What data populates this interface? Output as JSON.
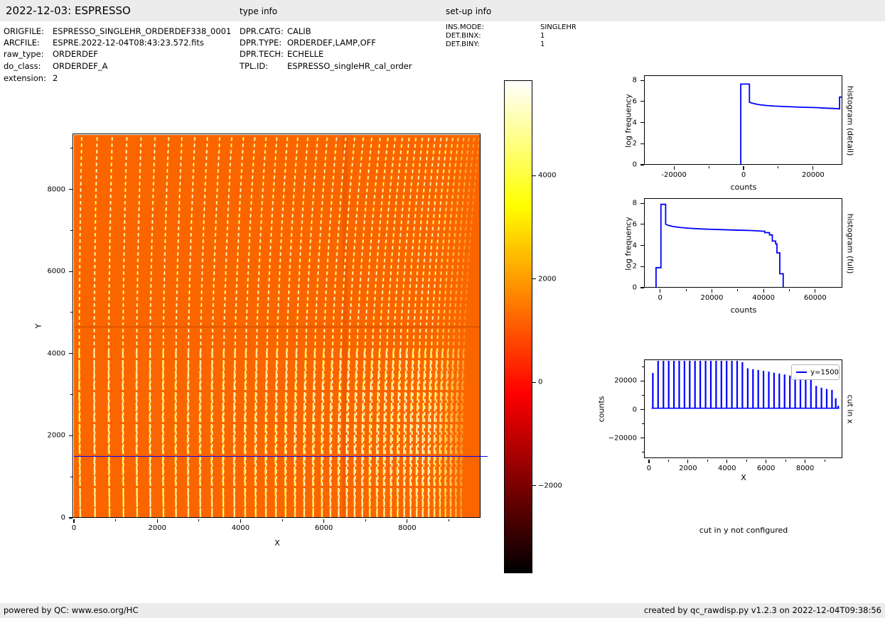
{
  "header": {
    "title": "2022-12-03: ESPRESSO",
    "type_info_label": "type info",
    "setup_info_label": "set-up info"
  },
  "file_info": {
    "rows": [
      {
        "label": "ORIGFILE:",
        "value": "ESPRESSO_SINGLEHR_ORDERDEF338_0001"
      },
      {
        "label": "ARCFILE:",
        "value": "ESPRE.2022-12-04T08:43:23.572.fits"
      },
      {
        "label": "raw_type:",
        "value": "ORDERDEF"
      },
      {
        "label": "do_class:",
        "value": "ORDERDEF_A"
      },
      {
        "label": "extension:",
        "value": "2"
      }
    ]
  },
  "type_info": {
    "rows": [
      {
        "label": "DPR.CATG:",
        "value": "CALIB"
      },
      {
        "label": "DPR.TYPE:",
        "value": "ORDERDEF,LAMP,OFF"
      },
      {
        "label": "DPR.TECH:",
        "value": "ECHELLE"
      },
      {
        "label": "TPL.ID:",
        "value": "ESPRESSO_singleHR_cal_order"
      }
    ]
  },
  "setup_info": {
    "rows": [
      {
        "label": "INS.MODE:",
        "value": "SINGLEHR"
      },
      {
        "label": "DET.BINX:",
        "value": "1"
      },
      {
        "label": "DET.BINY:",
        "value": "1"
      }
    ]
  },
  "footer": {
    "left": "powered by QC: www.eso.org/HC",
    "right": "created by qc_rawdisp.py v1.2.3 on 2022-12-04T09:38:56"
  },
  "colors": {
    "line_blue": "#0000ff",
    "image_orange": "#fb6500",
    "order_glow": "#ffc800",
    "order_core": "#ffffff",
    "chip_gap": "#d44f00",
    "bar_gray": "#ececec"
  },
  "chart_data": [
    {
      "id": "raw_image",
      "type": "heatmap",
      "xlabel": "X",
      "ylabel": "Y",
      "xlim": [
        0,
        9760
      ],
      "ylim": [
        0,
        9325
      ],
      "xticks": {
        "major": [
          {
            "v": 0,
            "label": "0"
          },
          {
            "v": 2000,
            "label": "2000"
          },
          {
            "v": 4000,
            "label": "4000"
          },
          {
            "v": 6000,
            "label": "6000"
          },
          {
            "v": 8000,
            "label": "8000"
          }
        ],
        "minor": [
          1000,
          3000,
          5000,
          7000,
          9000
        ]
      },
      "yticks": {
        "major": [
          {
            "v": 0,
            "label": "0"
          },
          {
            "v": 2000,
            "label": "2000"
          },
          {
            "v": 4000,
            "label": "4000"
          },
          {
            "v": 6000,
            "label": "6000"
          },
          {
            "v": 8000,
            "label": "8000"
          }
        ],
        "minor": [
          1000,
          3000,
          5000,
          7000,
          9000
        ]
      },
      "cut_line_y": 1500,
      "chip_gap_y": 4650,
      "orders": {
        "count_max": 44,
        "x_start": 9,
        "gap_start": 20.8,
        "gap_decay": 0.974,
        "gap_min": 7.2,
        "lean_base": 2,
        "lean_step": 0.9,
        "lean_max": 26,
        "x_end": 548,
        "fade_start": 505,
        "split_y": 300
      }
    },
    {
      "id": "colorbar",
      "type": "colorbar",
      "colormap": "hot",
      "vmin": -3670,
      "vmax": 5850,
      "ticks": [
        {
          "v": 4000,
          "label": "4000"
        },
        {
          "v": 2000,
          "label": "2000"
        },
        {
          "v": 0,
          "label": "0"
        },
        {
          "v": -2000,
          "label": "−2000"
        }
      ],
      "stops": [
        {
          "pos": 0,
          "color": "#000000"
        },
        {
          "pos": 0.365,
          "color": "#ff0000"
        },
        {
          "pos": 0.746,
          "color": "#ffff00"
        },
        {
          "pos": 1,
          "color": "#ffffff"
        }
      ]
    },
    {
      "id": "histogram_detail",
      "type": "line",
      "xlabel": "counts",
      "ylabel": "log frequency",
      "right_label": "histogram (detail)",
      "xlim": [
        -28200,
        28400
      ],
      "ylim": [
        0,
        8.35
      ],
      "xticks": {
        "major": [
          {
            "v": -20000,
            "label": "-20000"
          },
          {
            "v": 0,
            "label": "0"
          },
          {
            "v": 20000,
            "label": "20000"
          }
        ],
        "minor": [
          -10000,
          10000
        ]
      },
      "yticks": {
        "major": [
          {
            "v": 0,
            "label": "0"
          },
          {
            "v": 2,
            "label": "2"
          },
          {
            "v": 4,
            "label": "4"
          },
          {
            "v": 6,
            "label": "6"
          },
          {
            "v": 8,
            "label": "8"
          }
        ],
        "minor": []
      },
      "points": [
        [
          -28200,
          0
        ],
        [
          -800,
          0
        ],
        [
          -800,
          7.65
        ],
        [
          1700,
          7.65
        ],
        [
          1700,
          5.92
        ],
        [
          3000,
          5.8
        ],
        [
          4500,
          5.7
        ],
        [
          6500,
          5.62
        ],
        [
          9000,
          5.56
        ],
        [
          12000,
          5.52
        ],
        [
          15000,
          5.48
        ],
        [
          18000,
          5.45
        ],
        [
          21000,
          5.42
        ],
        [
          24000,
          5.37
        ],
        [
          26500,
          5.33
        ],
        [
          27600,
          5.3
        ],
        [
          27600,
          6.42
        ],
        [
          28300,
          6.42
        ]
      ]
    },
    {
      "id": "histogram_full",
      "type": "line",
      "xlabel": "counts",
      "ylabel": "log frequency",
      "right_label": "histogram (full)",
      "xlim": [
        -5700,
        70500
      ],
      "ylim": [
        0,
        8.35
      ],
      "xticks": {
        "major": [
          {
            "v": 0,
            "label": "0"
          },
          {
            "v": 20000,
            "label": "20000"
          },
          {
            "v": 40000,
            "label": "40000"
          },
          {
            "v": 60000,
            "label": "60000"
          }
        ],
        "minor": [
          10000,
          30000,
          50000
        ]
      },
      "yticks": {
        "major": [
          {
            "v": 0,
            "label": "0"
          },
          {
            "v": 2,
            "label": "2"
          },
          {
            "v": 4,
            "label": "4"
          },
          {
            "v": 6,
            "label": "6"
          },
          {
            "v": 8,
            "label": "8"
          }
        ],
        "minor": []
      },
      "points": [
        [
          -5700,
          0
        ],
        [
          -1600,
          0
        ],
        [
          -1600,
          1.9
        ],
        [
          300,
          1.9
        ],
        [
          300,
          7.9
        ],
        [
          2100,
          7.9
        ],
        [
          2100,
          6.02
        ],
        [
          3200,
          5.9
        ],
        [
          5000,
          5.8
        ],
        [
          8000,
          5.7
        ],
        [
          12000,
          5.62
        ],
        [
          16000,
          5.57
        ],
        [
          20000,
          5.53
        ],
        [
          24000,
          5.5
        ],
        [
          28000,
          5.47
        ],
        [
          32000,
          5.44
        ],
        [
          35000,
          5.42
        ],
        [
          38000,
          5.38
        ],
        [
          40500,
          5.35
        ],
        [
          40500,
          5.22
        ],
        [
          42300,
          5.22
        ],
        [
          42300,
          5.0
        ],
        [
          43400,
          5.0
        ],
        [
          43400,
          4.42
        ],
        [
          44700,
          4.42
        ],
        [
          44700,
          4.15
        ],
        [
          45200,
          4.15
        ],
        [
          45200,
          3.3
        ],
        [
          46300,
          3.3
        ],
        [
          46300,
          1.32
        ],
        [
          47600,
          1.32
        ],
        [
          47600,
          0
        ],
        [
          48400,
          0
        ],
        [
          70500,
          0
        ]
      ]
    },
    {
      "id": "cut_in_x",
      "type": "spikes",
      "xlabel": "X",
      "ylabel": "counts",
      "right_label": "cut in x",
      "legend": "y=1500",
      "xlim": [
        -180,
        9910
      ],
      "ylim": [
        -34000,
        34000
      ],
      "xticks": {
        "major": [
          {
            "v": 0,
            "label": "0"
          },
          {
            "v": 2000,
            "label": "2000"
          },
          {
            "v": 4000,
            "label": "4000"
          },
          {
            "v": 6000,
            "label": "6000"
          },
          {
            "v": 8000,
            "label": "8000"
          }
        ],
        "minor": [
          1000,
          3000,
          5000,
          7000,
          9000
        ]
      },
      "yticks": {
        "major": [
          {
            "v": -20000,
            "label": "−20000"
          },
          {
            "v": 0,
            "label": "0"
          },
          {
            "v": 20000,
            "label": "20000"
          }
        ],
        "minor": [
          -30000,
          -10000,
          10000,
          30000
        ]
      },
      "baseline": 900,
      "baseline_range": [
        130,
        9750
      ],
      "spikes": [
        [
          200,
          25500
        ],
        [
          470,
          34500
        ],
        [
          740,
          34500
        ],
        [
          1010,
          34500
        ],
        [
          1280,
          34500
        ],
        [
          1550,
          34500
        ],
        [
          1820,
          34500
        ],
        [
          2090,
          34500
        ],
        [
          2360,
          34500
        ],
        [
          2630,
          34500
        ],
        [
          2900,
          34500
        ],
        [
          3170,
          34500
        ],
        [
          3440,
          34500
        ],
        [
          3710,
          34500
        ],
        [
          3980,
          34500
        ],
        [
          4250,
          34500
        ],
        [
          4520,
          34500
        ],
        [
          4790,
          33000
        ],
        [
          5060,
          28800
        ],
        [
          5330,
          28200
        ],
        [
          5600,
          27600
        ],
        [
          5870,
          27000
        ],
        [
          6140,
          26400
        ],
        [
          6410,
          25700
        ],
        [
          6680,
          25100
        ],
        [
          6950,
          24500
        ],
        [
          7220,
          23700
        ],
        [
          7490,
          22800
        ],
        [
          7760,
          22000
        ],
        [
          8030,
          21300
        ],
        [
          8300,
          20700
        ],
        [
          8570,
          16500
        ],
        [
          8840,
          15300
        ],
        [
          9110,
          14400
        ],
        [
          9380,
          13700
        ],
        [
          9570,
          7800
        ],
        [
          9700,
          2600
        ]
      ]
    },
    {
      "id": "cut_in_y_note",
      "type": "text",
      "text": "cut in y not configured"
    }
  ]
}
